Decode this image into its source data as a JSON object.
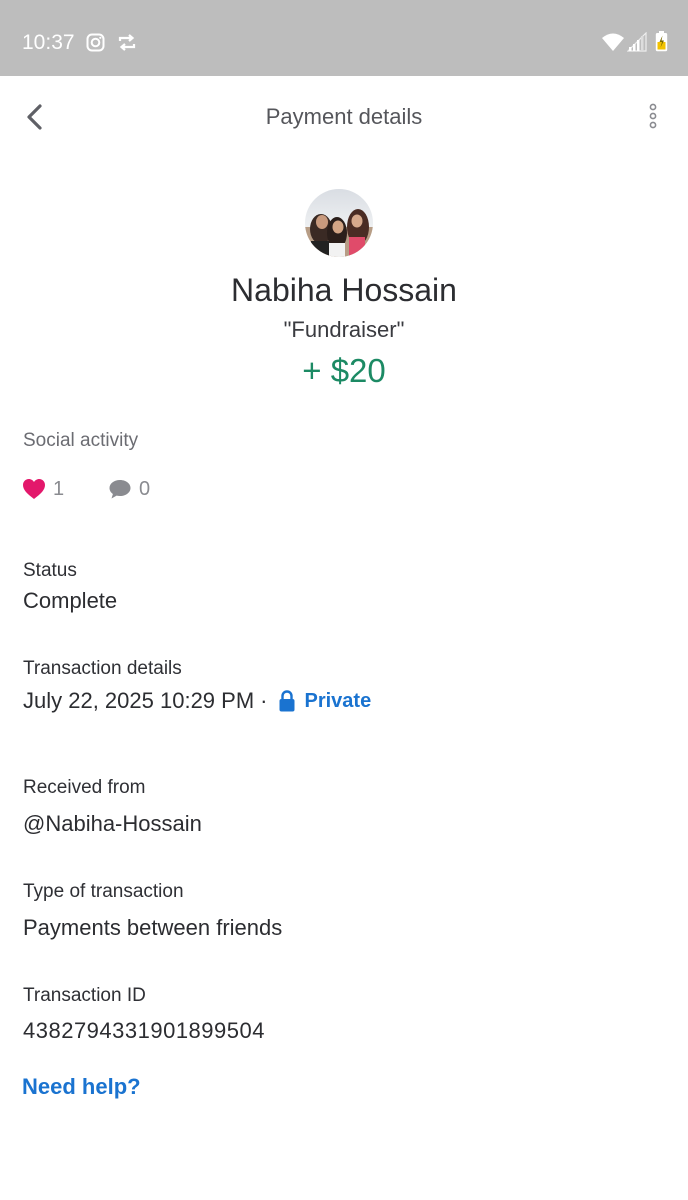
{
  "status_bar": {
    "time": "10:37",
    "icons": [
      "instagram-icon",
      "repeat-icon",
      "wifi-icon",
      "signal-icon",
      "battery-icon"
    ]
  },
  "header": {
    "title": "Payment details",
    "back_icon": "chevron-left-icon",
    "more_icon": "more-vertical-icon"
  },
  "profile": {
    "name": "Nabiha Hossain",
    "note": "\"Fundraiser\"",
    "amount": "+ $20",
    "amount_color": "#1c8a64"
  },
  "social": {
    "heading": "Social activity",
    "likes": "1",
    "comments": "0",
    "like_color": "#e3186b"
  },
  "details": {
    "status_label": "Status",
    "status_value": "Complete",
    "transaction_label": "Transaction details",
    "transaction_datetime": "July 22, 2025 10:29 PM",
    "separator": "·",
    "privacy": "Private",
    "received_from_label": "Received from",
    "received_from_value": "@Nabiha-Hossain",
    "type_label": "Type of transaction",
    "type_value": "Payments between friends",
    "id_label": "Transaction ID",
    "id_value": "4382794331901899504"
  },
  "help": {
    "label": "Need help?"
  },
  "colors": {
    "status_bar": "#bdbdbd",
    "link": "#1a73d0",
    "text": "#2c2d31",
    "muted": "#8a8b90"
  }
}
